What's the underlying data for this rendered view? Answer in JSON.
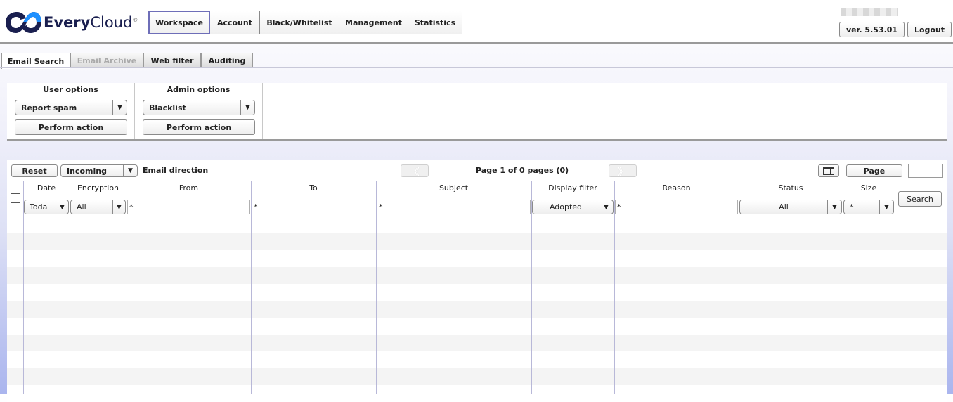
{
  "app": {
    "logo_every": "Every",
    "logo_cloud": "Cloud",
    "logo_mark": "®",
    "brand_color": "#1a1f4f",
    "accent_color": "#1e90ff"
  },
  "topnav": {
    "items": [
      {
        "label": "Workspace",
        "active": true
      },
      {
        "label": "Account"
      },
      {
        "label": "Black/Whitelist"
      },
      {
        "label": "Management"
      },
      {
        "label": "Statistics"
      }
    ]
  },
  "header": {
    "version": "ver. 5.53.01",
    "logout": "Logout"
  },
  "subtabs": [
    {
      "label": "Email Search",
      "active": true
    },
    {
      "label": "Email Archive",
      "disabled": true
    },
    {
      "label": "Web filter"
    },
    {
      "label": "Auditing"
    }
  ],
  "options": {
    "user": {
      "title": "User options",
      "selected": "Report spam",
      "action": "Perform action"
    },
    "admin": {
      "title": "Admin options",
      "selected": "Blacklist",
      "action": "Perform action"
    }
  },
  "toolbar": {
    "reset": "Reset",
    "direction_selected": "Incoming",
    "direction_label": "Email direction",
    "pager_prev": "《",
    "pager_next": "》",
    "pager_text": "Page 1 of 0 pages (0)",
    "page_button": "Page",
    "page_input": ""
  },
  "columns": {
    "date": "Date",
    "encryption": "Encryption",
    "from": "From",
    "to": "To",
    "subject": "Subject",
    "display_filter": "Display filter",
    "reason": "Reason",
    "status": "Status",
    "size": "Size"
  },
  "filters": {
    "date": "Toda",
    "encryption": "All",
    "from": "*",
    "to": "*",
    "subject": "*",
    "display_filter": "Adopted",
    "reason": "*",
    "status": "All",
    "size": "*",
    "search": "Search"
  },
  "icons": {
    "dropdown_arrow": "▼",
    "column_chooser": "columns-icon"
  }
}
